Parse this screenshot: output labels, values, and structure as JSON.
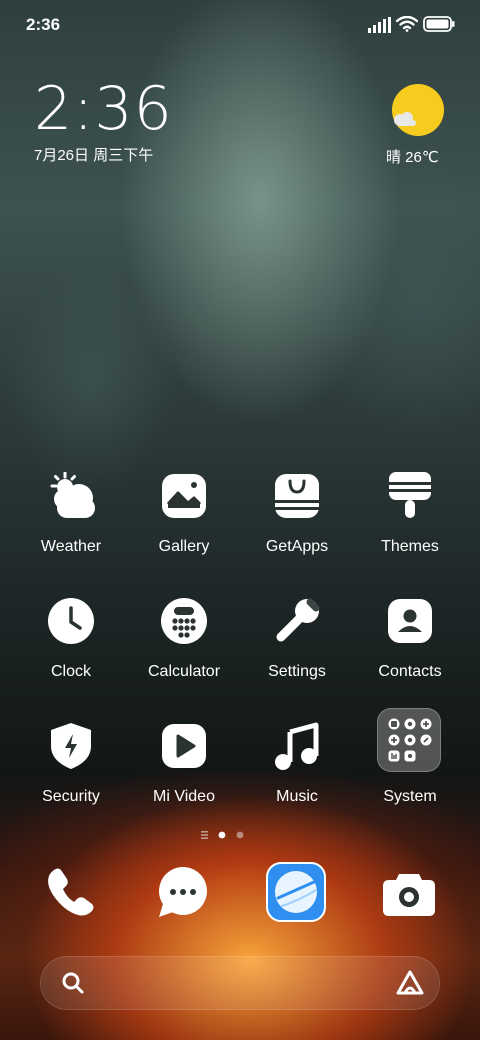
{
  "status_bar": {
    "time": "2:36",
    "icons": [
      "signal-icon",
      "wifi-icon",
      "battery-icon"
    ]
  },
  "clock_widget": {
    "time": "2:36",
    "date": "7月26日 周三下午"
  },
  "weather_widget": {
    "icon": "sunny-icon",
    "condition_temp": "晴 26℃"
  },
  "apps": [
    {
      "label": "Weather",
      "icon": "weather-icon"
    },
    {
      "label": "Gallery",
      "icon": "gallery-icon"
    },
    {
      "label": "GetApps",
      "icon": "getapps-icon"
    },
    {
      "label": "Themes",
      "icon": "themes-icon"
    },
    {
      "label": "Clock",
      "icon": "clock-icon"
    },
    {
      "label": "Calculator",
      "icon": "calculator-icon"
    },
    {
      "label": "Settings",
      "icon": "settings-icon"
    },
    {
      "label": "Contacts",
      "icon": "contacts-icon"
    },
    {
      "label": "Security",
      "icon": "security-icon"
    },
    {
      "label": "Mi Video",
      "icon": "mi-video-icon"
    },
    {
      "label": "Music",
      "icon": "music-icon"
    },
    {
      "label": "System",
      "icon": "folder-icon"
    }
  ],
  "page_indicator": {
    "pages": 2,
    "current": 1
  },
  "dock": [
    {
      "icon": "phone-icon"
    },
    {
      "icon": "messages-icon"
    },
    {
      "icon": "browser-icon"
    },
    {
      "icon": "camera-icon"
    }
  ],
  "search_bar": {
    "icons": [
      "search-icon",
      "assistant-icon"
    ]
  },
  "colors": {
    "sun": "#f7cc1f",
    "browser_blue": "#2f8ff0",
    "icon_white": "#ffffff"
  }
}
